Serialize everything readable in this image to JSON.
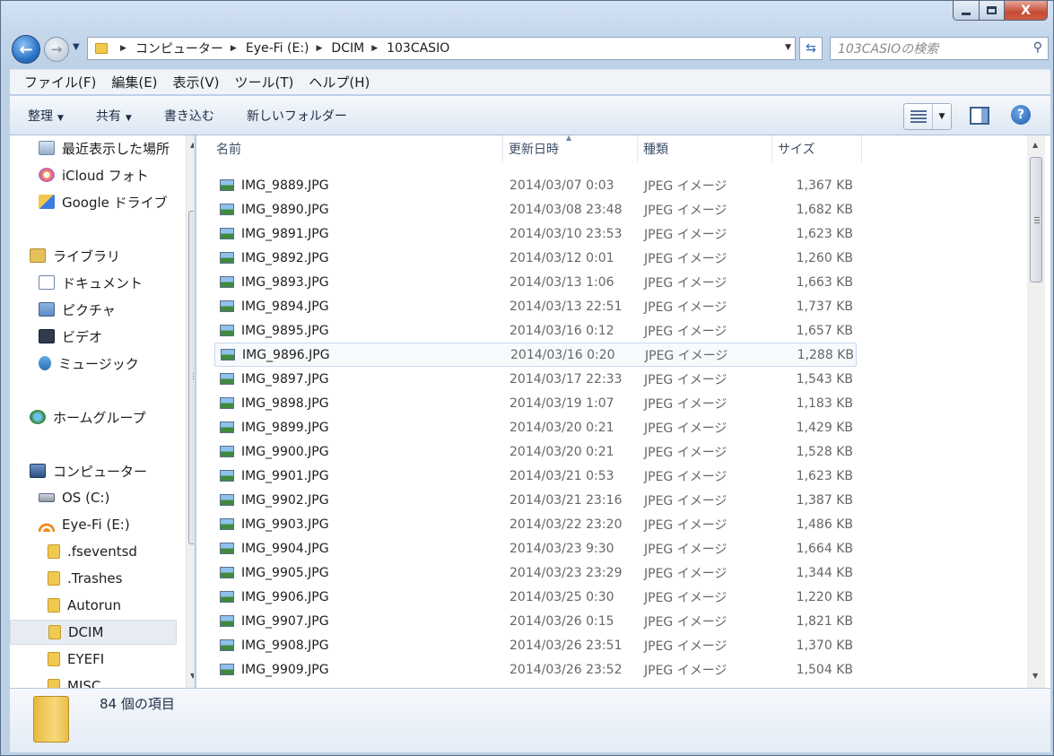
{
  "window": {
    "close_glyph": "X"
  },
  "nav": {
    "back_glyph": "←",
    "forward_glyph": "→",
    "breadcrumbs": [
      "コンピューター",
      "Eye-Fi (E:)",
      "DCIM",
      "103CASIO"
    ],
    "search_placeholder": "103CASIOの検索"
  },
  "menu": {
    "items": [
      "ファイル(F)",
      "編集(E)",
      "表示(V)",
      "ツール(T)",
      "ヘルプ(H)"
    ]
  },
  "toolbar": {
    "organize_label": "整理",
    "share_label": "共有",
    "burn_label": "書き込む",
    "new_folder_label": "新しいフォルダー",
    "help_glyph": "?"
  },
  "sidebar": {
    "items": [
      {
        "label": "最近表示した場所",
        "icon": "recent-places-icon"
      },
      {
        "label": "iCloud フォト",
        "icon": "icloud-photos-icon"
      },
      {
        "label": "Google ドライブ",
        "icon": "google-drive-icon"
      },
      {
        "label": "ライブラリ",
        "icon": "library-icon"
      },
      {
        "label": "ドキュメント",
        "icon": "documents-icon"
      },
      {
        "label": "ピクチャ",
        "icon": "pictures-icon"
      },
      {
        "label": "ビデオ",
        "icon": "videos-icon"
      },
      {
        "label": "ミュージック",
        "icon": "music-icon"
      },
      {
        "label": "ホームグループ",
        "icon": "homegroup-icon"
      },
      {
        "label": "コンピューター",
        "icon": "computer-icon"
      },
      {
        "label": "OS (C:)",
        "icon": "drive-icon"
      },
      {
        "label": "Eye-Fi (E:)",
        "icon": "wifi-drive-icon"
      },
      {
        "label": ".fseventsd",
        "icon": "folder-icon"
      },
      {
        "label": ".Trashes",
        "icon": "folder-icon"
      },
      {
        "label": "Autorun",
        "icon": "folder-icon"
      },
      {
        "label": "DCIM",
        "icon": "folder-icon"
      },
      {
        "label": "EYEFI",
        "icon": "folder-icon"
      },
      {
        "label": "MISC",
        "icon": "folder-icon"
      }
    ],
    "selected_label": "DCIM"
  },
  "columns": {
    "name": "名前",
    "date": "更新日時",
    "type": "種類",
    "size": "サイズ"
  },
  "files": [
    {
      "name": "IMG_9889.JPG",
      "date": "2014/03/07 0:03",
      "type": "JPEG イメージ",
      "size": "1,367 KB"
    },
    {
      "name": "IMG_9890.JPG",
      "date": "2014/03/08 23:48",
      "type": "JPEG イメージ",
      "size": "1,682 KB"
    },
    {
      "name": "IMG_9891.JPG",
      "date": "2014/03/10 23:53",
      "type": "JPEG イメージ",
      "size": "1,623 KB"
    },
    {
      "name": "IMG_9892.JPG",
      "date": "2014/03/12 0:01",
      "type": "JPEG イメージ",
      "size": "1,260 KB"
    },
    {
      "name": "IMG_9893.JPG",
      "date": "2014/03/13 1:06",
      "type": "JPEG イメージ",
      "size": "1,663 KB"
    },
    {
      "name": "IMG_9894.JPG",
      "date": "2014/03/13 22:51",
      "type": "JPEG イメージ",
      "size": "1,737 KB"
    },
    {
      "name": "IMG_9895.JPG",
      "date": "2014/03/16 0:12",
      "type": "JPEG イメージ",
      "size": "1,657 KB"
    },
    {
      "name": "IMG_9896.JPG",
      "date": "2014/03/16 0:20",
      "type": "JPEG イメージ",
      "size": "1,288 KB"
    },
    {
      "name": "IMG_9897.JPG",
      "date": "2014/03/17 22:33",
      "type": "JPEG イメージ",
      "size": "1,543 KB"
    },
    {
      "name": "IMG_9898.JPG",
      "date": "2014/03/19 1:07",
      "type": "JPEG イメージ",
      "size": "1,183 KB"
    },
    {
      "name": "IMG_9899.JPG",
      "date": "2014/03/20 0:21",
      "type": "JPEG イメージ",
      "size": "1,429 KB"
    },
    {
      "name": "IMG_9900.JPG",
      "date": "2014/03/20 0:21",
      "type": "JPEG イメージ",
      "size": "1,528 KB"
    },
    {
      "name": "IMG_9901.JPG",
      "date": "2014/03/21 0:53",
      "type": "JPEG イメージ",
      "size": "1,623 KB"
    },
    {
      "name": "IMG_9902.JPG",
      "date": "2014/03/21 23:16",
      "type": "JPEG イメージ",
      "size": "1,387 KB"
    },
    {
      "name": "IMG_9903.JPG",
      "date": "2014/03/22 23:20",
      "type": "JPEG イメージ",
      "size": "1,486 KB"
    },
    {
      "name": "IMG_9904.JPG",
      "date": "2014/03/23 9:30",
      "type": "JPEG イメージ",
      "size": "1,664 KB"
    },
    {
      "name": "IMG_9905.JPG",
      "date": "2014/03/23 23:29",
      "type": "JPEG イメージ",
      "size": "1,344 KB"
    },
    {
      "name": "IMG_9906.JPG",
      "date": "2014/03/25 0:30",
      "type": "JPEG イメージ",
      "size": "1,220 KB"
    },
    {
      "name": "IMG_9907.JPG",
      "date": "2014/03/26 0:15",
      "type": "JPEG イメージ",
      "size": "1,821 KB"
    },
    {
      "name": "IMG_9908.JPG",
      "date": "2014/03/26 23:51",
      "type": "JPEG イメージ",
      "size": "1,370 KB"
    },
    {
      "name": "IMG_9909.JPG",
      "date": "2014/03/26 23:52",
      "type": "JPEG イメージ",
      "size": "1,504 KB"
    }
  ],
  "hovered_file": "IMG_9896.JPG",
  "status": {
    "item_count": "84 個の項目"
  }
}
